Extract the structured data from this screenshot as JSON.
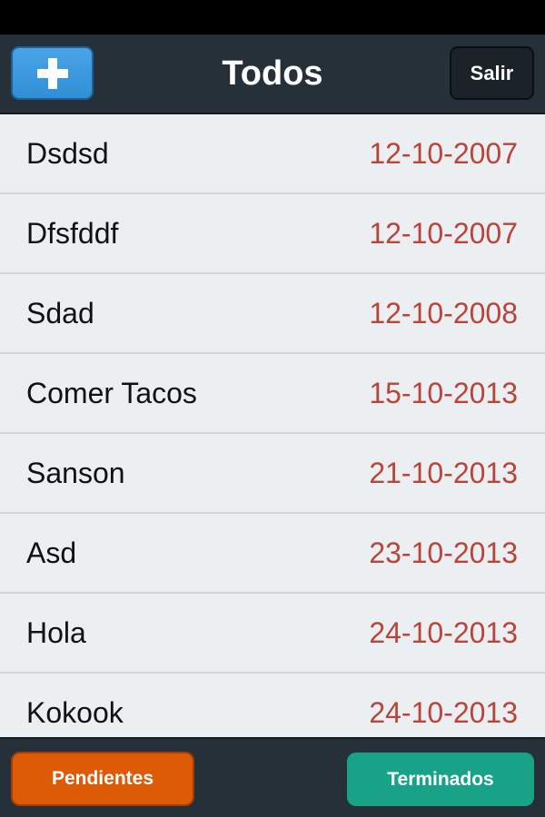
{
  "nav": {
    "title": "Todos",
    "add_icon": "plus-icon",
    "logout_label": "Salir",
    "add_color": "#3b97dd"
  },
  "todos": [
    {
      "name": "Dsdsd",
      "date": "12-10-2007"
    },
    {
      "name": "Dfsfddf",
      "date": "12-10-2007"
    },
    {
      "name": "Sdad",
      "date": "12-10-2008"
    },
    {
      "name": "Comer Tacos",
      "date": "15-10-2013"
    },
    {
      "name": "Sanson",
      "date": "21-10-2013"
    },
    {
      "name": "Asd",
      "date": "23-10-2013"
    },
    {
      "name": "Hola",
      "date": "24-10-2013"
    },
    {
      "name": "Kokook",
      "date": "24-10-2013"
    }
  ],
  "tabs": {
    "pending_label": "Pendientes",
    "done_label": "Terminados",
    "pending_color": "#dd5a07",
    "done_color": "#18a389"
  },
  "colors": {
    "nav_bg": "#253039",
    "date_text": "#b8443a",
    "list_bg": "#eceff1"
  }
}
